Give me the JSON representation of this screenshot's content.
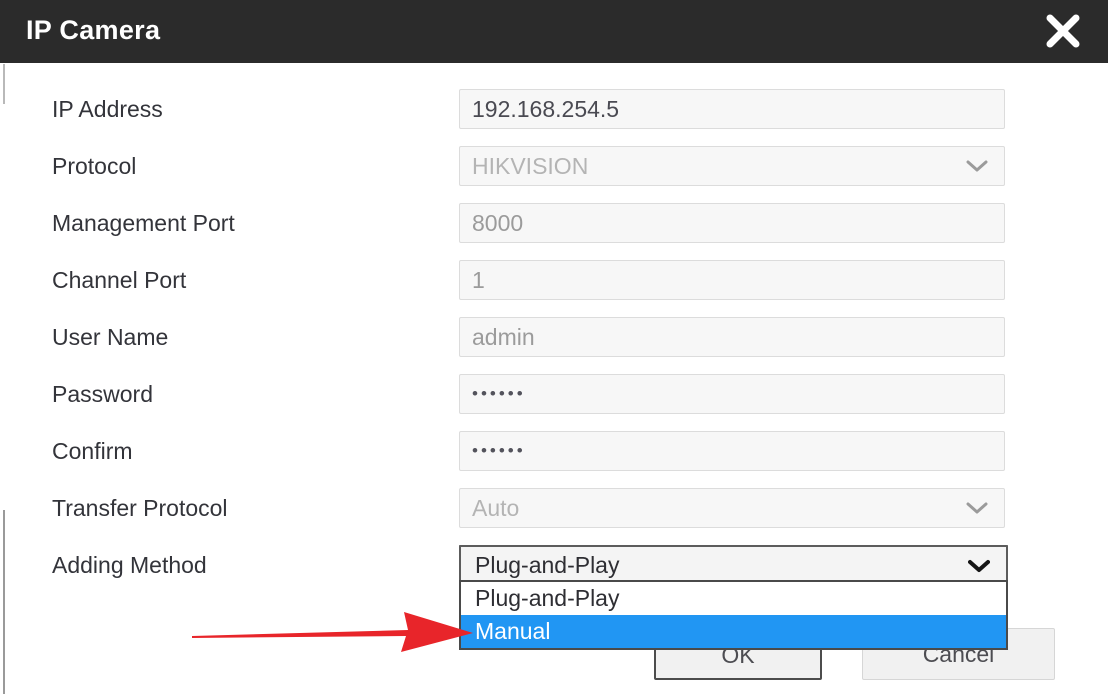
{
  "dialog": {
    "title": "IP Camera",
    "close_icon": "close-icon"
  },
  "form": {
    "fields": [
      {
        "label": "IP Address",
        "value": "192.168.254.5",
        "type": "text",
        "tone": "strong"
      },
      {
        "label": "Protocol",
        "value": "HIKVISION",
        "type": "select",
        "tone": "muted"
      },
      {
        "label": "Management Port",
        "value": "8000",
        "type": "text",
        "tone": "mid"
      },
      {
        "label": "Channel Port",
        "value": "1",
        "type": "text",
        "tone": "mid"
      },
      {
        "label": "User Name",
        "value": "admin",
        "type": "text",
        "tone": "mid"
      },
      {
        "label": "Password",
        "value": "••••••",
        "type": "password",
        "tone": "mid"
      },
      {
        "label": "Confirm",
        "value": "••••••",
        "type": "password",
        "tone": "mid"
      },
      {
        "label": "Transfer Protocol",
        "value": "Auto",
        "type": "select",
        "tone": "muted"
      },
      {
        "label": "Adding Method",
        "value": "Plug-and-Play",
        "type": "select-open",
        "tone": "strong"
      }
    ]
  },
  "dropdown": {
    "options": [
      {
        "label": "Plug-and-Play",
        "selected": false
      },
      {
        "label": "Manual",
        "selected": true
      }
    ],
    "highlight_color": "#2196f3"
  },
  "footer": {
    "ok_label": "OK",
    "cancel_label": "Cancel"
  },
  "annotation": {
    "arrow_color": "#e8252a",
    "points_to": "Manual"
  }
}
